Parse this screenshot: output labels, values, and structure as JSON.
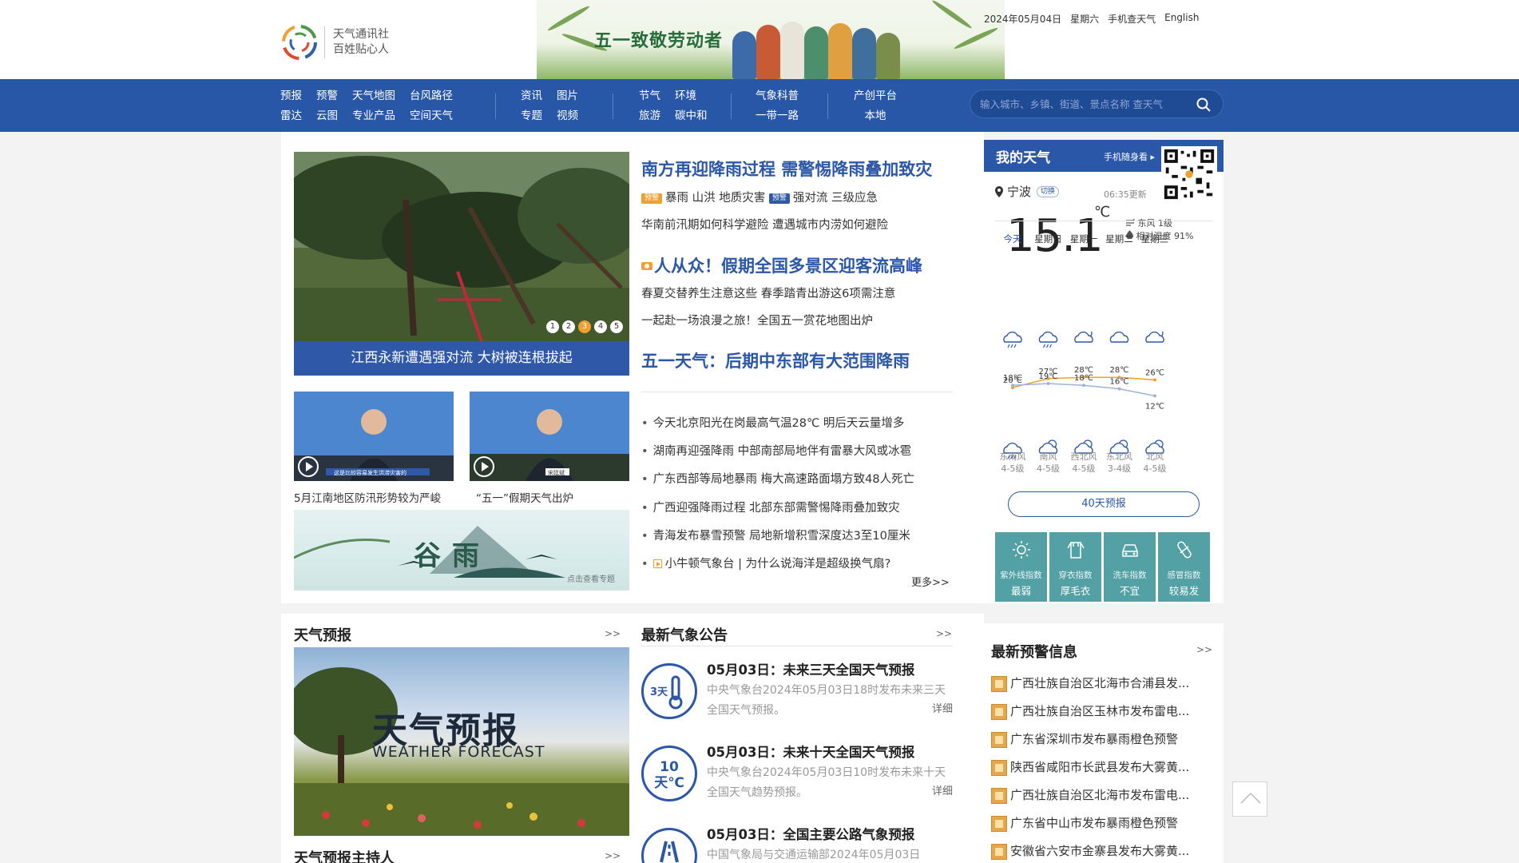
{
  "header": {
    "logo_line1": "天气通讯社",
    "logo_line2": "百姓贴心人",
    "banner_title": "五一致敬劳动者",
    "date": "2024年05月04日",
    "weekday": "星期六",
    "mobile_link": "手机查天气",
    "english_link": "English"
  },
  "nav": {
    "group1": [
      "预报",
      "雷达",
      "预警",
      "云图",
      "天气地图",
      "专业产品",
      "台风路径",
      "空间天气"
    ],
    "group2": [
      "资讯",
      "专题",
      "图片",
      "视频"
    ],
    "group3": [
      "节气",
      "旅游",
      "环境",
      "碳中和"
    ],
    "group4": [
      "气象科普",
      "一带一路"
    ],
    "group5": [
      "产创平台",
      "本地"
    ],
    "search_placeholder": "输入城市、乡镇、街道、景点名称 查天气"
  },
  "hero": {
    "caption": "江西永新遭遇强对流 大树被连根拔起",
    "dots": [
      "1",
      "2",
      "3",
      "4",
      "5"
    ],
    "active_dot": 3
  },
  "headlines": {
    "h1": "南方再迎降雨过程 需警惕降雨叠加致灾",
    "h1_tag1": "预警",
    "h1_sub1": "暴雨 山洪 地质灾害",
    "h1_tag2": "预警",
    "h1_sub2": "强对流 三级应急",
    "h1_line2": "华南前汛期如何科学避险 遭遇城市内涝如何避险",
    "h2": "人从众！假期全国多景区迎客流高峰",
    "h2_line1": "春夏交替养生注意这些 春季踏青出游这6项需注意",
    "h2_line2": "一起赴一场浪漫之旅！全国五一赏花地图出炉",
    "h3": "五一天气：后期中东部有大范围降雨"
  },
  "videos": {
    "v1_caption": "5月江南地区防汛形势较为严峻",
    "v1_banner": "这是比较容易发生洪涝灾害的",
    "v2_caption": "“五一”假期天气出炉",
    "v2_banner": "宋廷斌",
    "guyu_text": "谷雨",
    "guyu_hint": "点击查看专题"
  },
  "news": [
    "今天北京阳光在岗最高气温28℃ 明后天云量增多",
    "湖南再迎强降雨 中部南部局地伴有雷暴大风或冰雹",
    "广东西部等局地暴雨  梅大高速路面塌方致48人死亡",
    "广西迎强降雨过程 北部东部需警惕降雨叠加致灾",
    "青海发布暴雪预警 局地新增积雪深度达3至10厘米",
    "小牛顿气象台 | 为什么说海洋是超级换气扇?"
  ],
  "news_more": "更多>>",
  "forecast_section": {
    "title": "天气预报",
    "more": ">>",
    "image_title": "天气预报",
    "image_sub": "WEATHER FORECAST",
    "next_title": "天气预报主持人",
    "next_more": ">>"
  },
  "notices_section": {
    "title": "最新气象公告",
    "more": ">>",
    "items": [
      {
        "icon": "3天",
        "title": "05月03日：未来三天全国天气预报",
        "desc": "中央气象台2024年05月03日18时发布未来三天全国天气预报。",
        "detail": "详细"
      },
      {
        "icon": "10天℃",
        "title": "05月03日：未来十天全国天气预报",
        "desc": "中央气象台2024年05月03日10时发布未来十天全国天气趋势预报。",
        "detail": "详细"
      },
      {
        "icon": "",
        "title": "05月03日：全国主要公路气象预报",
        "desc": "中国气象局与交通运输部2024年05月03日",
        "detail": ""
      }
    ]
  },
  "weather": {
    "title": "我的天气",
    "mobile": "手机随身看",
    "city": "宁波",
    "switch": "切换",
    "updated": "06:35更新",
    "temp": "15.1",
    "unit": "℃",
    "wind": "东风 1级",
    "humidity": "相对湿度 91%",
    "days": [
      "今天",
      "星期日",
      "星期一",
      "星期二",
      "星期三"
    ],
    "high_temps": [
      20,
      27,
      28,
      28,
      26
    ],
    "low_temps": [
      18,
      19,
      18,
      16,
      12
    ],
    "high_labels": [
      "20℃",
      "27℃",
      "28℃",
      "28℃",
      "26℃"
    ],
    "low_labels": [
      "18℃",
      "19℃",
      "18℃",
      "16℃",
      "12℃"
    ],
    "winds": [
      [
        "东南风",
        "4-5级"
      ],
      [
        "南风",
        "4-5级"
      ],
      [
        "西北风",
        "4-5级"
      ],
      [
        "东北风",
        "3-4级"
      ],
      [
        "北风",
        "4-5级"
      ]
    ],
    "forecast_button": "40天预报",
    "indices": [
      {
        "name": "紫外线指数",
        "value": "最弱",
        "icon": "sun-icon"
      },
      {
        "name": "穿衣指数",
        "value": "厚毛衣",
        "icon": "clothes-icon"
      },
      {
        "name": "洗车指数",
        "value": "不宜",
        "icon": "car-icon"
      },
      {
        "name": "感冒指数",
        "value": "较易发",
        "icon": "pill-icon"
      }
    ],
    "line_color": "#f0a030",
    "low_line_color": "#9cb3dc"
  },
  "warnings": {
    "title": "最新预警信息",
    "more": ">>",
    "items": [
      "广西壮族自治区北海市合浦县发...",
      "广西壮族自治区玉林市发布雷电...",
      "广东省深圳市发布暴雨橙色预警",
      "陕西省咸阳市长武县发布大雾黄...",
      "广西壮族自治区北海市发布雷电...",
      "广东省中山市发布暴雨橙色预警",
      "安徽省六安市金寨县发布大雾黄..."
    ]
  },
  "colors": {
    "brand_blue": "#2957a8",
    "accent_orange": "#f0a030",
    "index_teal": "#53a0a5"
  }
}
